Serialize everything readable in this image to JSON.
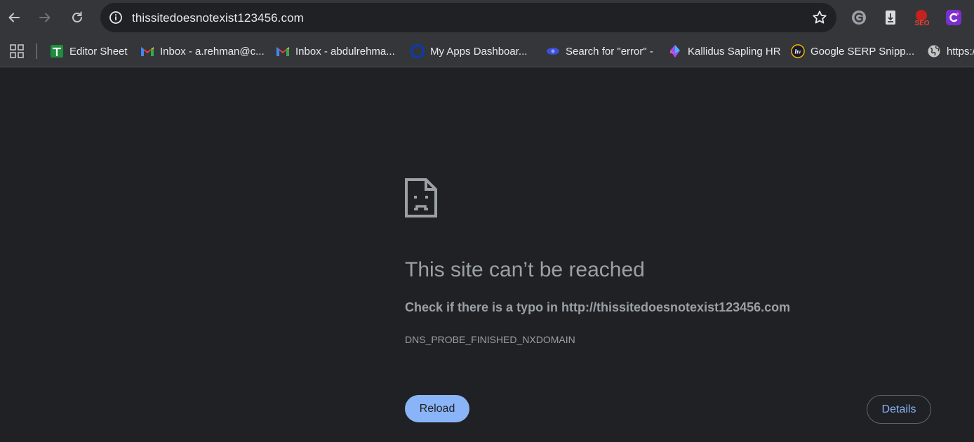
{
  "browser": {
    "url": "thissitedoesnotexist123456.com",
    "icons": {
      "back": "arrow-left-icon",
      "forward": "arrow-right-icon",
      "reload": "reload-icon",
      "site_info": "info-icon",
      "bookmark_star": "star-icon"
    },
    "extensions": [
      {
        "name": "grammarly-icon"
      },
      {
        "name": "extension-icon"
      },
      {
        "name": "seo-icon",
        "label": "SEO"
      },
      {
        "name": "c-extension-icon"
      }
    ]
  },
  "bookmarks": [
    {
      "label": "Editor Sheet",
      "icon": "google-sheets-icon"
    },
    {
      "label": "Inbox - a.rehman@c...",
      "icon": "gmail-icon"
    },
    {
      "label": "Inbox - abdulrehma...",
      "icon": "gmail-icon"
    },
    {
      "label": "My Apps Dashboar...",
      "icon": "okta-icon"
    },
    {
      "label": "Search for \"error\" -",
      "icon": "eye-icon"
    },
    {
      "label": "Kallidus Sapling HR",
      "icon": "kallidus-icon"
    },
    {
      "label": "Google SERP Snipp...",
      "icon": "hv-icon",
      "icon_text": "hv"
    },
    {
      "label": "https:/",
      "icon": "globe-icon"
    }
  ],
  "error": {
    "icon": "sad-page-icon",
    "title": "This site can’t be reached",
    "suggestion": "Check if there is a typo in http://thissitedoesnotexist123456.com",
    "code": "DNS_PROBE_FINISHED_NXDOMAIN",
    "reload_label": "Reload",
    "details_label": "Details"
  },
  "colors": {
    "background": "#202124",
    "toolbar": "#35363a",
    "accent": "#8ab4f8",
    "muted_text": "#9aa0a6"
  }
}
